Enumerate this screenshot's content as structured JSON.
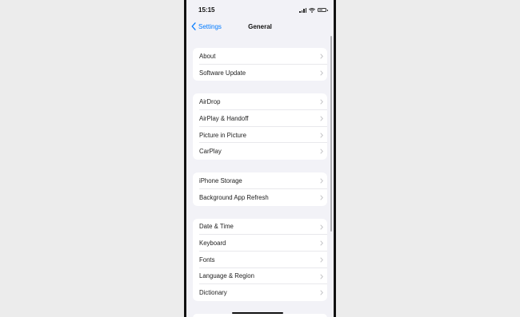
{
  "status_bar": {
    "time": "15:15",
    "icons": [
      "signal-icon",
      "wifi-icon",
      "battery-icon"
    ]
  },
  "nav": {
    "back_label": "Settings",
    "title": "General"
  },
  "groups": [
    {
      "items": [
        "About",
        "Software Update"
      ]
    },
    {
      "items": [
        "AirDrop",
        "AirPlay & Handoff",
        "Picture in Picture",
        "CarPlay"
      ]
    },
    {
      "items": [
        "iPhone Storage",
        "Background App Refresh"
      ]
    },
    {
      "items": [
        "Date & Time",
        "Keyboard",
        "Fonts",
        "Language & Region",
        "Dictionary"
      ]
    }
  ],
  "colors": {
    "accent": "#007aff",
    "background": "#f2f2f7",
    "cell": "#ffffff"
  }
}
